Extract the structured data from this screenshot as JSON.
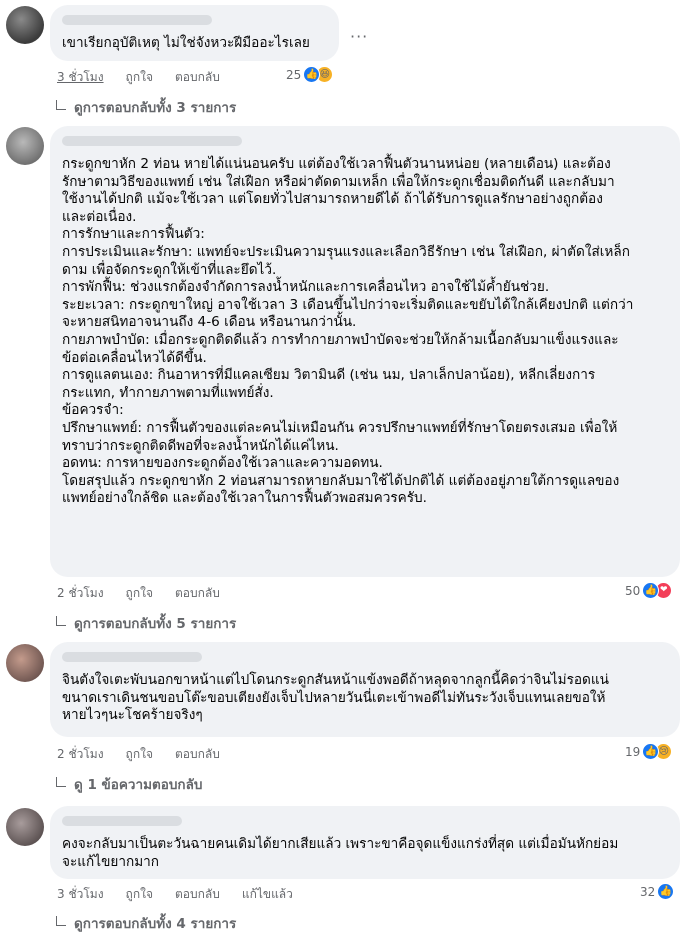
{
  "comments": [
    {
      "text": "เขาเรียกอุบัติเหตุ ไม่ใช่จังหวะฝีมืออะไรเลย",
      "time": "3 ชั่วโมง",
      "like": "ถูกใจ",
      "reply": "ตอบกลับ",
      "reactions_count": "25",
      "reaction_types": [
        "like-icon",
        "haha-icon"
      ],
      "more": "...",
      "view_replies": "ดูการตอบกลับทั้ง 3 รายการ"
    },
    {
      "text": "กระดูกขาหัก 2 ท่อน หายได้แน่นอนครับ แต่ต้องใช้เวลาฟื้นตัวนานหน่อย (หลายเดือน) และต้อง\nรักษาตามวิธีของแพทย์ เช่น ใส่เฝือก หรือผ่าตัดดามเหล็ก เพื่อให้กระดูกเชื่อมติดกันดี และกลับมา\nใช้งานได้ปกติ แม้จะใช้เวลา แต่โดยทั่วไปสามารถหายดีได้ ถ้าได้รับการดูแลรักษาอย่างถูกต้อง\nและต่อเนื่อง.\nการรักษาและการฟื้นตัว:\nการประเมินและรักษา: แพทย์จะประเมินความรุนแรงและเลือกวิธีรักษา เช่น ใส่เฝือก, ผ่าตัดใส่เหล็ก\nดาม เพื่อจัดกระดูกให้เข้าที่และยึดไว้.\nการพักฟื้น: ช่วงแรกต้องจำกัดการลงน้ำหนักและการเคลื่อนไหว อาจใช้ไม้ค้ำยันช่วย.\nระยะเวลา: กระดูกขาใหญ่ อาจใช้เวลา 3 เดือนขึ้นไปกว่าจะเริ่มติดและขยับได้ใกล้เคียงปกติ แต่กว่า\nจะหายสนิทอาจนานถึง 4-6 เดือน หรือนานกว่านั้น.\nกายภาพบำบัด: เมื่อกระดูกติดดีแล้ว การทำกายภาพบำบัดจะช่วยให้กล้ามเนื้อกลับมาแข็งแรงและ\nข้อต่อเคลื่อนไหวได้ดีขึ้น.\nการดูแลตนเอง: กินอาหารที่มีแคลเซียม วิตามินดี (เช่น นม, ปลาเล็กปลาน้อย), หลีกเลี่ยงการ\nกระแทก, ทำกายภาพตามที่แพทย์สั่ง.\nข้อควรจำ:\nปรึกษาแพทย์: การฟื้นตัวของแต่ละคนไม่เหมือนกัน ควรปรึกษาแพทย์ที่รักษาโดยตรงเสมอ เพื่อให้\nทราบว่ากระดูกติดดีพอที่จะลงน้ำหนักได้แค่ไหน.\nอดทน: การหายของกระดูกต้องใช้เวลาและความอดทน.\nโดยสรุปแล้ว กระดูกขาหัก 2 ท่อนสามารถหายกลับมาใช้ได้ปกติได้ แต่ต้องอยู่ภายใต้การดูแลของ\nแพทย์อย่างใกล้ชิด และต้องใช้เวลาในการฟื้นตัวพอสมควรครับ.",
      "time": "2 ชั่วโมง",
      "like": "ถูกใจ",
      "reply": "ตอบกลับ",
      "reactions_count": "50",
      "reaction_types": [
        "like-icon",
        "love-icon"
      ],
      "view_replies": "ดูการตอบกลับทั้ง 5 รายการ"
    },
    {
      "text": "จินตังใจเตะพับนอกขาหน้าแต่ไปโดนกระดูกสันหน้าแข้งพอดีถ้าหลุดจากลูกนี้คิดว่าจินไม่รอดแน่\nขนาดเราเดินชนขอบโต๊ะขอบเตียงยังเจ็บไปหลายวันนี่เตะเข้าพอดีไม่ทันระวังเจ็บแทนเลยขอให้\nหายไวๆนะโชคร้ายจริงๆ",
      "time": "2 ชั่วโมง",
      "like": "ถูกใจ",
      "reply": "ตอบกลับ",
      "reactions_count": "19",
      "reaction_types": [
        "like-icon",
        "sad-icon"
      ],
      "view_replies": "ดู 1 ข้อความตอบกลับ"
    },
    {
      "text": "คงจะกลับมาเป็นตะวันฉายคนเดิมได้ยากเสียแล้ว เพราะขาคือจุดแข็งแกร่งที่สุด แต่เมื่อมันหักย่อม\nจะแก้ไขยากมาก",
      "time": "3 ชั่วโมง",
      "like": "ถูกใจ",
      "reply": "ตอบกลับ",
      "edited": "แก้ไขแล้ว",
      "reactions_count": "32",
      "reaction_types": [
        "like-icon"
      ],
      "view_replies": "ดูการตอบกลับทั้ง 4 รายการ"
    }
  ]
}
